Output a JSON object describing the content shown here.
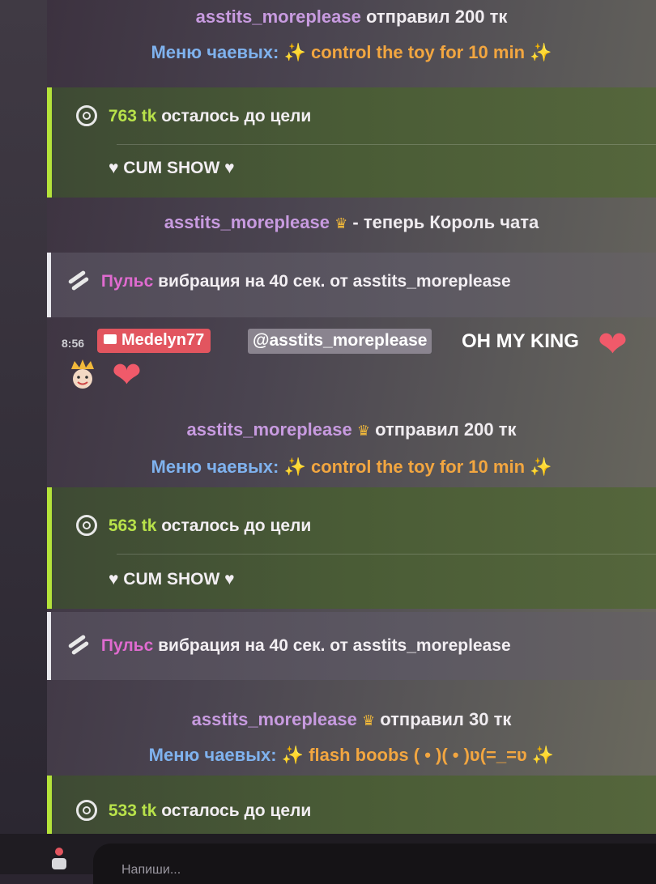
{
  "events": {
    "tip1": {
      "user": "asstits_moreplease",
      "action": "отправил 200 тк",
      "menu_label": "Меню чаевых:",
      "item": "control the toy for 10 min"
    },
    "goal1": {
      "remaining": "763 tk",
      "suffix": "осталось до цели",
      "title": "♥ CUM SHOW ♥"
    },
    "king": {
      "user": "asstits_moreplease",
      "text": "- теперь Король чата"
    },
    "pulse1": {
      "word": "Пульс",
      "text": "вибрация на 40 сек. от asstits_moreplease"
    },
    "message": {
      "time": "8:56",
      "author": "Medelyn77",
      "mention": "@asstits_moreplease",
      "text": "OH MY KING"
    },
    "tip2": {
      "user": "asstits_moreplease",
      "action": "отправил 200 тк",
      "menu_label": "Меню чаевых:",
      "item": "control the toy for 10 min"
    },
    "goal2": {
      "remaining": "563 tk",
      "suffix": "осталось до цели",
      "title": "♥ CUM SHOW ♥"
    },
    "pulse2": {
      "word": "Пульс",
      "text": "вибрация на 40 сек. от asstits_moreplease"
    },
    "tip3": {
      "user": "asstits_moreplease",
      "action": "отправил 30 тк",
      "menu_label": "Меню чаевых:",
      "item": "flash boobs ( • )( • )ʋ(=_=ʋ"
    },
    "goal3": {
      "remaining": "533 tk",
      "suffix": "осталось до цели"
    }
  },
  "composer": {
    "placeholder": "Напиши..."
  },
  "icons": [
    "sparkle-icon",
    "crown-icon",
    "target-icon",
    "vibration-icon",
    "camera-icon",
    "heart-icon",
    "king-emoji-icon",
    "user-icon"
  ],
  "colors": {
    "username": "#c89be0",
    "menu_label": "#7fb2ee",
    "tip_item": "#f2a640",
    "goal_bar": "#b5e33a",
    "pulse_word": "#e06bd0",
    "badge": "#e2555f"
  }
}
